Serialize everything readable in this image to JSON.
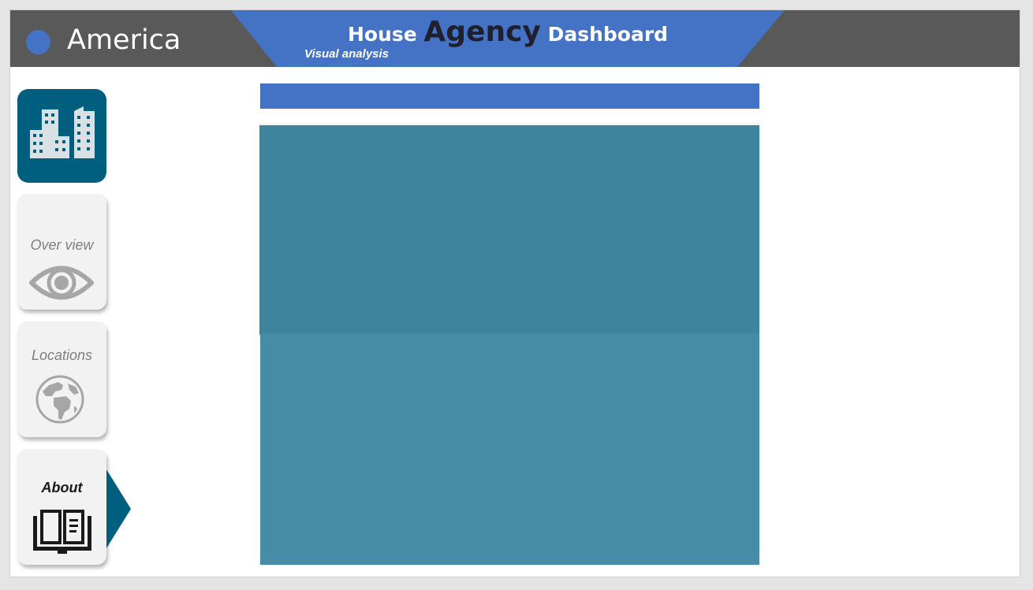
{
  "header": {
    "region": "America",
    "title_part1": "House",
    "title_emphasis": "Agency",
    "title_part2": "Dashboard",
    "subtitle": "Visual analysis"
  },
  "logo": {
    "icon": "buildings-icon"
  },
  "nav": {
    "items": [
      {
        "label": "Over view",
        "icon": "eye-icon",
        "active": false
      },
      {
        "label": "Locations",
        "icon": "globe-icon",
        "active": false
      },
      {
        "label": "About",
        "icon": "book-icon",
        "active": true
      }
    ]
  },
  "colors": {
    "header_bg": "#595959",
    "accent_blue": "#4472c4",
    "teal_dark": "#005f7f",
    "panel_upper": "#3d849c",
    "panel_lower": "#478ca6"
  }
}
